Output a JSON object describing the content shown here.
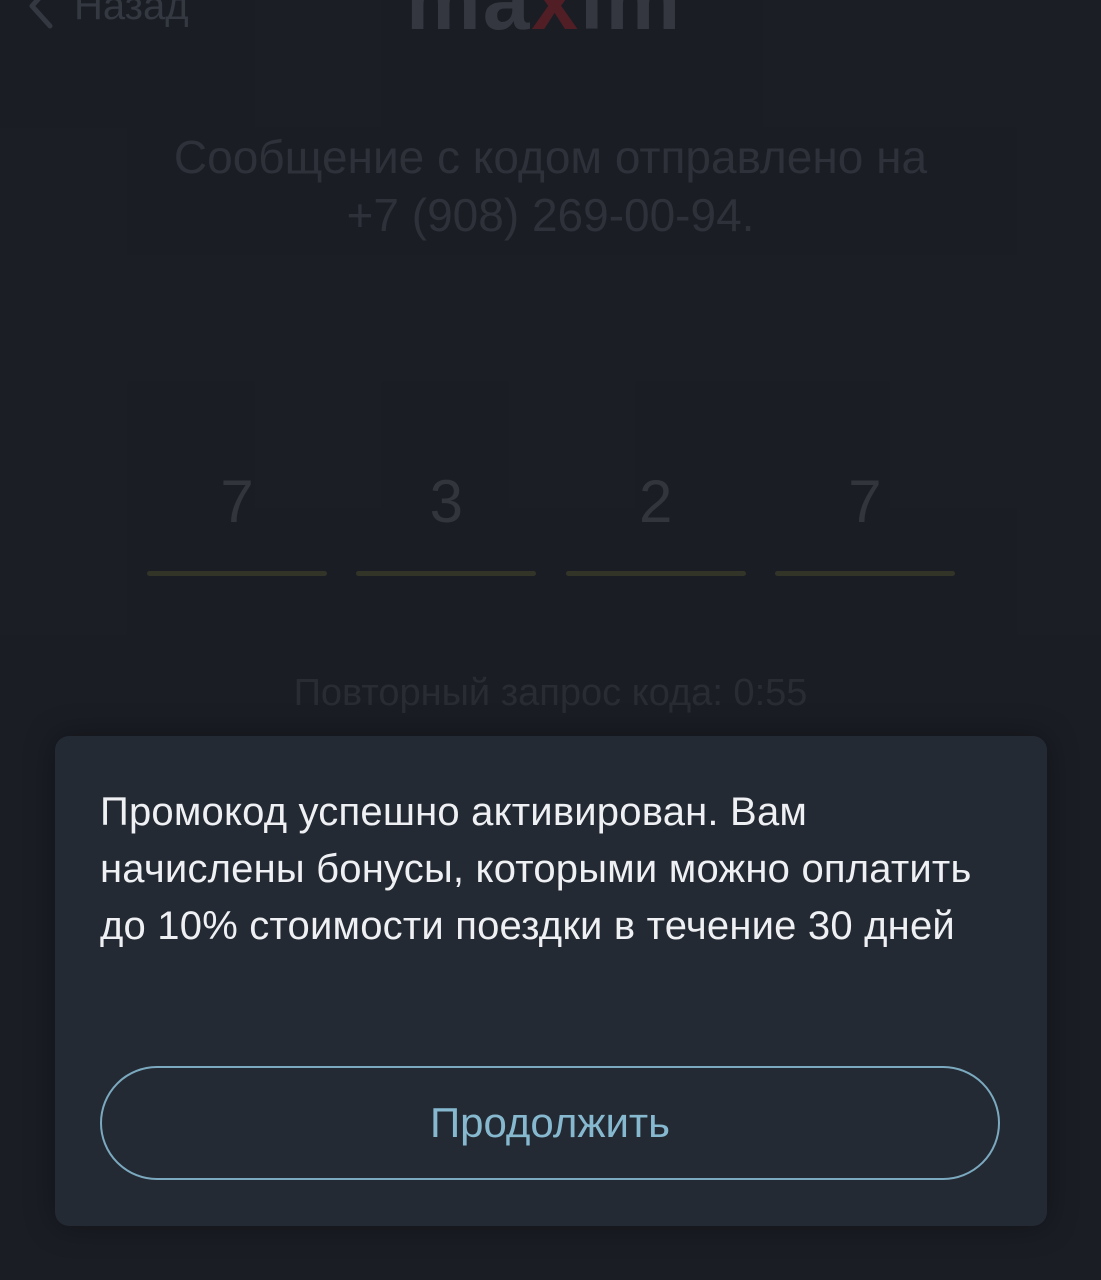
{
  "background": {
    "back_label": "Назад",
    "logo": {
      "prefix": "ma",
      "accent": "x",
      "suffix": "im"
    },
    "sent_message_line1": "Сообщение с кодом отправлено на",
    "sent_message_line2": "+7 (908) 269-00-94.",
    "code_digits": [
      "7",
      "3",
      "2",
      "7"
    ],
    "resend_text": "Повторный запрос кода: 0:55"
  },
  "modal": {
    "message": "Промокод успешно активирован. Вам начислены бонусы, которыми можно оплатить до 10% стоимости поездки в течение 30 дней",
    "continue_label": "Продолжить"
  },
  "colors": {
    "modal_background": "#242a33",
    "button_border": "#7ba9bf",
    "button_text": "#86b9d0",
    "brand_accent": "#e5262f"
  }
}
